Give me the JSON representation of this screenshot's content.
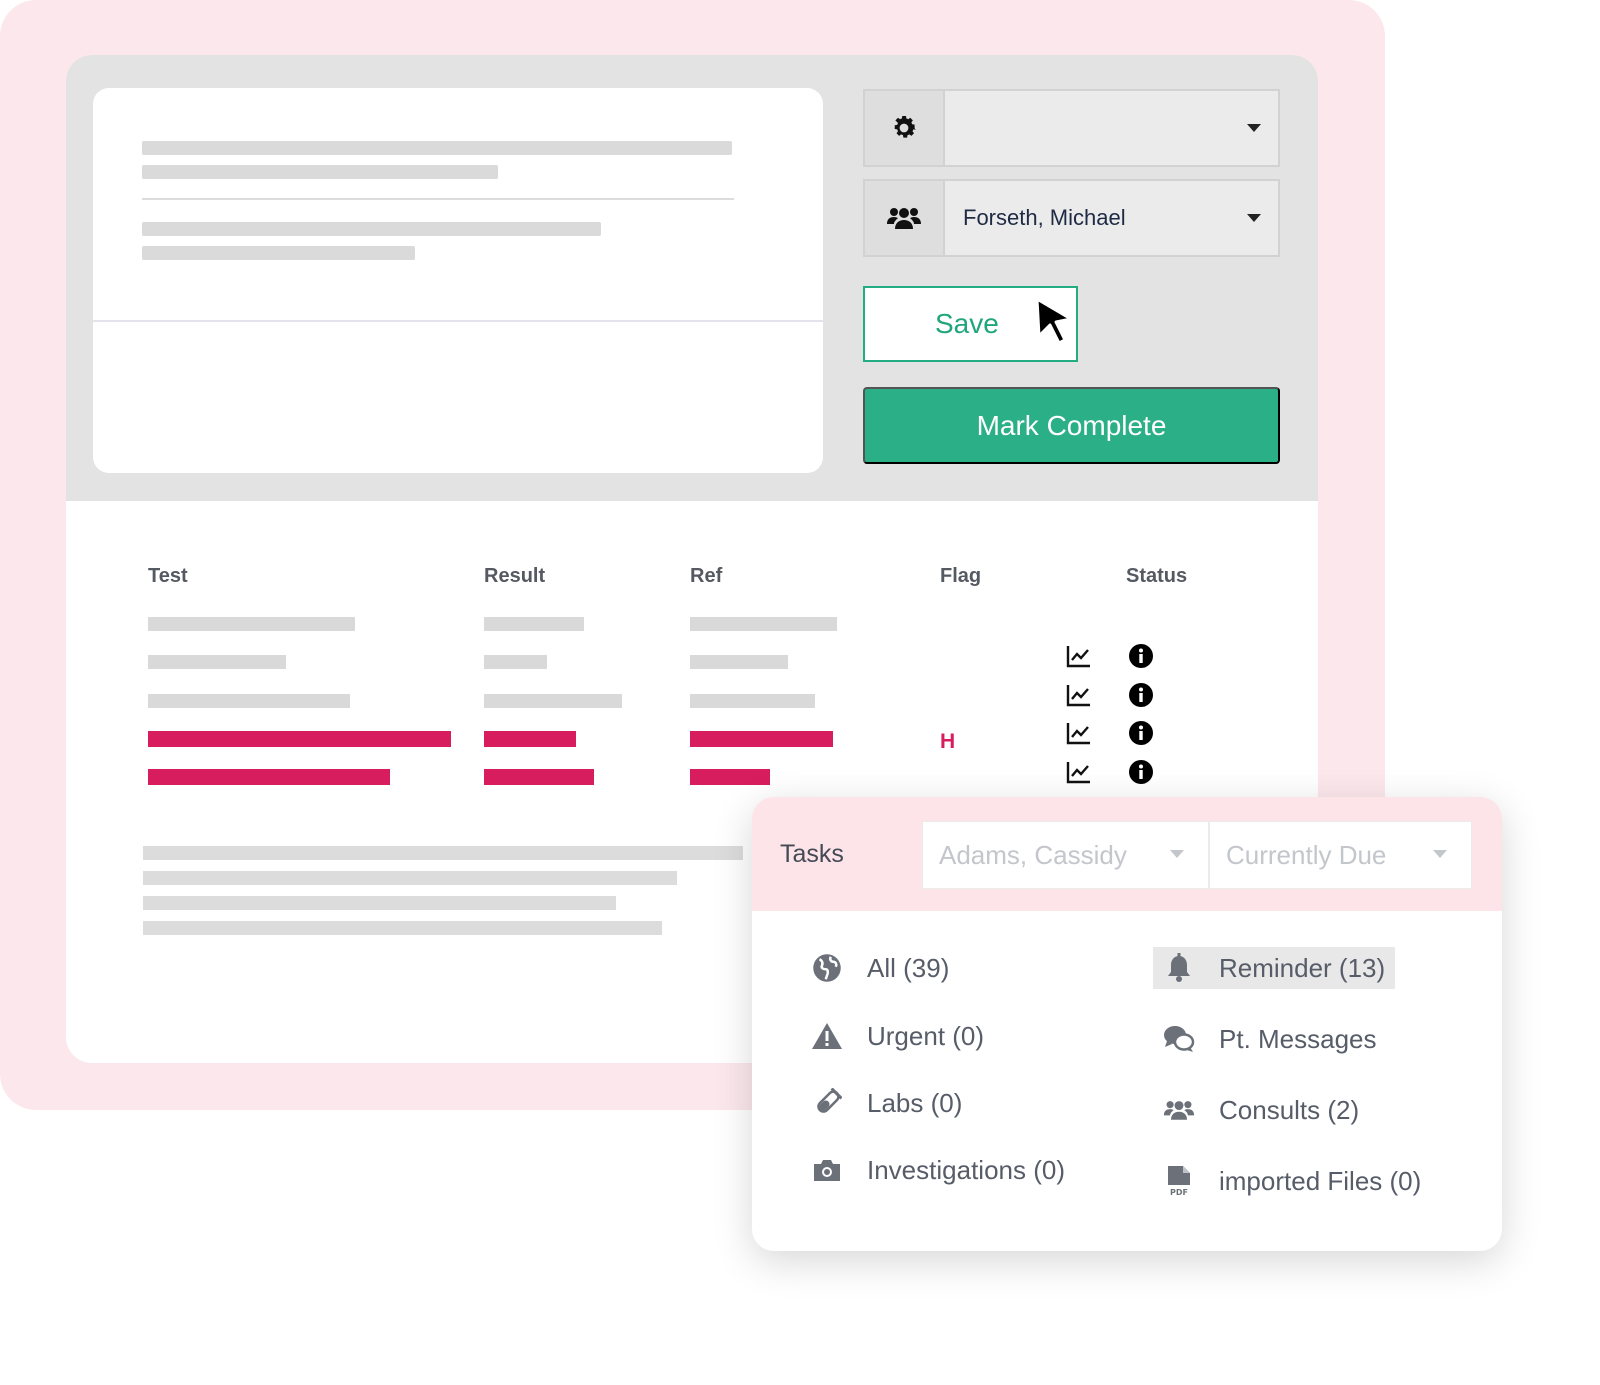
{
  "assignee": {
    "icon": "people-icon",
    "value": "Forseth, Michael"
  },
  "settings_select": {
    "icon": "gear-icon",
    "value": ""
  },
  "actions": {
    "save_label": "Save",
    "mark_complete_label": "Mark Complete"
  },
  "colors": {
    "accent": "#2aaf87",
    "flag_red": "#d81d5e",
    "tasks_header": "#fce4e9"
  },
  "results_table": {
    "columns": [
      "Test",
      "Result",
      "Ref",
      "Flag",
      "Status"
    ],
    "rows": [
      {
        "flag": "",
        "highlighted": false
      },
      {
        "flag": "",
        "highlighted": false
      },
      {
        "flag": "",
        "highlighted": false
      },
      {
        "flag": "H",
        "highlighted": true
      },
      {
        "flag": "",
        "highlighted": true
      }
    ]
  },
  "tasks_panel": {
    "title": "Tasks",
    "user_filter": "Adams, Cassidy",
    "due_filter": "Currently Due",
    "categories_left": [
      {
        "label": "All (39)",
        "icon": "globe-icon"
      },
      {
        "label": "Urgent (0)",
        "icon": "warning-icon"
      },
      {
        "label": "Labs (0)",
        "icon": "test-tube-icon"
      },
      {
        "label": "Investigations (0)",
        "icon": "camera-icon"
      }
    ],
    "categories_right": [
      {
        "label": "Reminder (13)",
        "icon": "bell-icon",
        "selected": true
      },
      {
        "label": "Pt. Messages",
        "icon": "chat-bubbles-icon",
        "selected": false
      },
      {
        "label": "Consults (2)",
        "icon": "people-icon",
        "selected": false
      },
      {
        "label": "imported Files (0)",
        "icon": "pdf-file-icon",
        "selected": false
      }
    ]
  }
}
